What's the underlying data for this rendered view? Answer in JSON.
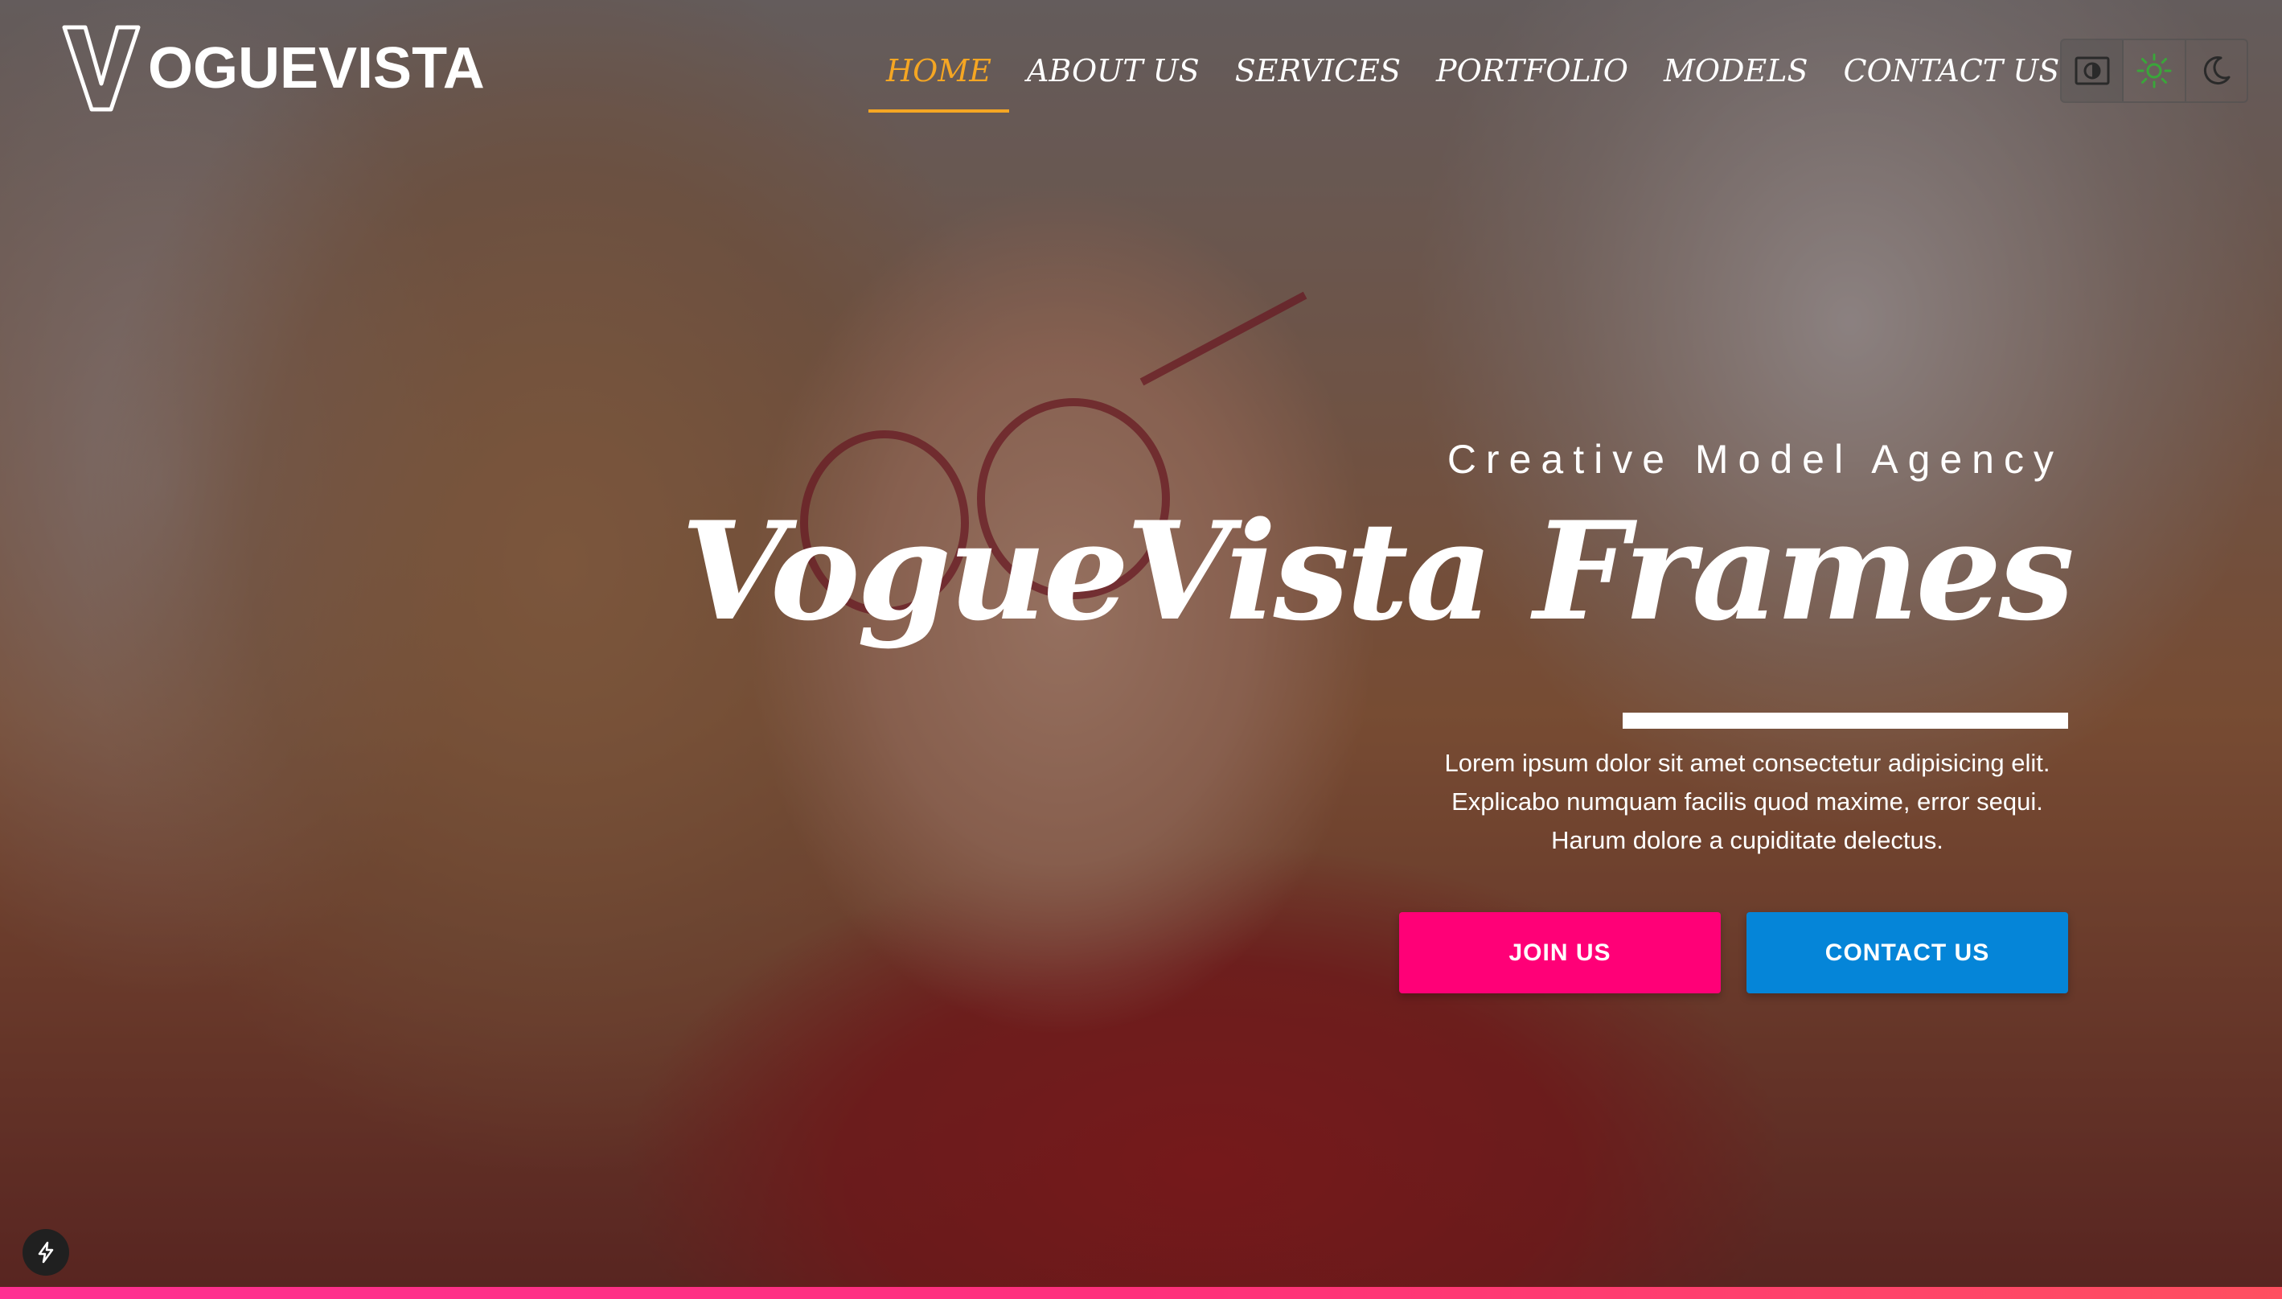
{
  "brand": {
    "logo_text": "OGUEVISTA",
    "logo_mark": "V"
  },
  "nav": {
    "items": [
      {
        "label": "HOME",
        "active": true
      },
      {
        "label": "ABOUT US",
        "active": false
      },
      {
        "label": "SERVICES",
        "active": false
      },
      {
        "label": "PORTFOLIO",
        "active": false
      },
      {
        "label": "MODELS",
        "active": false
      },
      {
        "label": "CONTACT US",
        "active": false
      }
    ],
    "active_color": "#f5a623"
  },
  "theme_toggle": {
    "options": [
      {
        "icon": "contrast-icon",
        "selected": false
      },
      {
        "icon": "sun-icon",
        "selected": true
      },
      {
        "icon": "moon-icon",
        "selected": false
      }
    ]
  },
  "hero": {
    "kicker": "Creative Model Agency",
    "title": "VogueVista Frames",
    "description": "Lorem ipsum dolor sit amet consectetur adipisicing elit. Explicabo numquam facilis quod maxime, error sequi. Harum dolore a cupiditate delectus.",
    "buttons": {
      "join": {
        "label": "JOIN US",
        "color": "#ff0077"
      },
      "contact": {
        "label": "CONTACT US",
        "color": "#0585d8"
      }
    }
  },
  "dev_badge": {
    "icon": "lightning-icon"
  }
}
